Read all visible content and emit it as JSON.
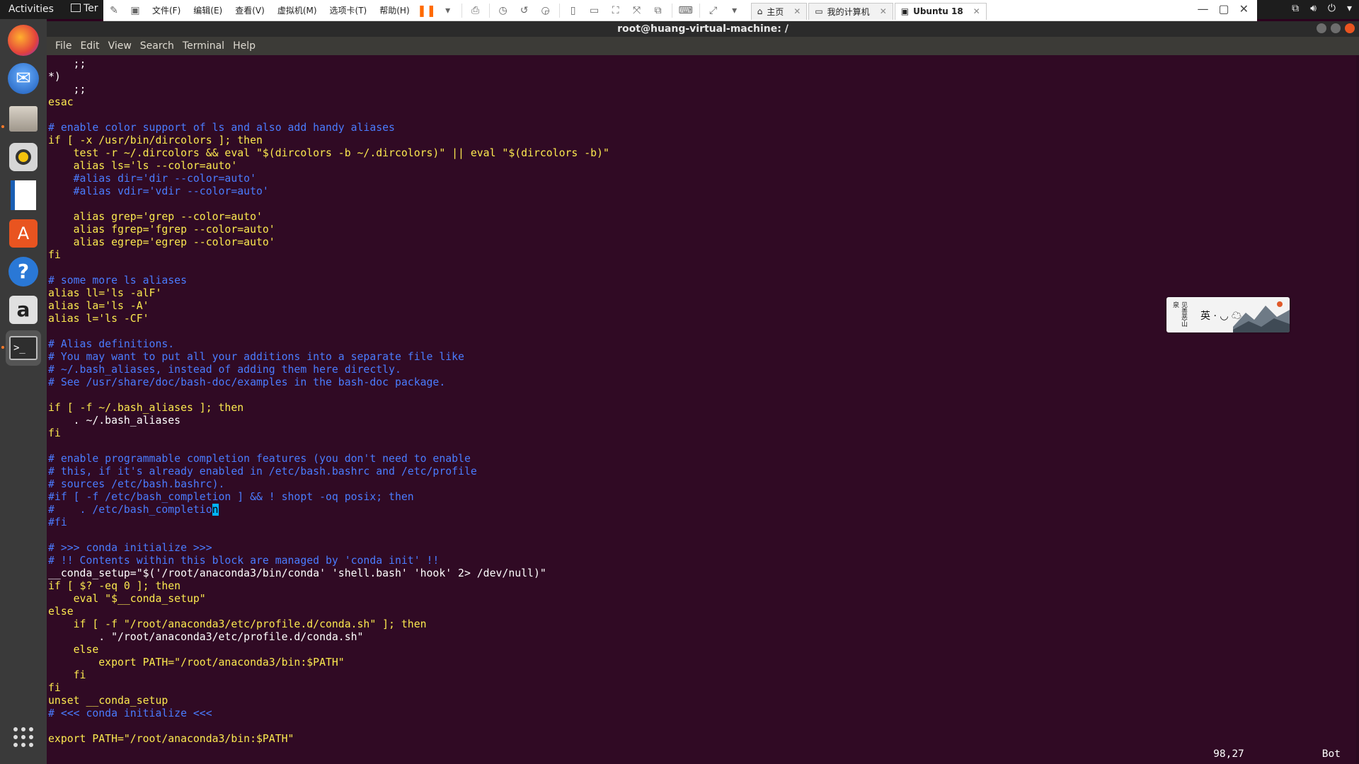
{
  "topbar": {
    "activities": "Activities",
    "app_indicator": "Ter"
  },
  "vmware": {
    "menus": [
      "文件(F)",
      "编辑(E)",
      "查看(V)",
      "虚拟机(M)",
      "选项卡(T)",
      "帮助(H)"
    ],
    "tabs": [
      {
        "label": "主页",
        "active": false
      },
      {
        "label": "我的计算机",
        "active": false
      },
      {
        "label": "Ubuntu 18",
        "active": true
      }
    ]
  },
  "terminal": {
    "title": "root@huang-virtual-machine: /",
    "menu": [
      "File",
      "Edit",
      "View",
      "Search",
      "Terminal",
      "Help"
    ],
    "status_position": "98,27",
    "status_scroll": "Bot"
  },
  "widget": {
    "left_text": "见善恶山泉",
    "mid_text": "英 · ◡ ☁"
  },
  "code_lines": [
    "    ;;",
    "*)",
    "    ;;",
    "esac",
    "",
    "# enable color support of ls and also add handy aliases",
    "if [ -x /usr/bin/dircolors ]; then",
    "    test -r ~/.dircolors && eval \"$(dircolors -b ~/.dircolors)\" || eval \"$(dircolors -b)\"",
    "    alias ls='ls --color=auto'",
    "    #alias dir='dir --color=auto'",
    "    #alias vdir='vdir --color=auto'",
    "",
    "    alias grep='grep --color=auto'",
    "    alias fgrep='fgrep --color=auto'",
    "    alias egrep='egrep --color=auto'",
    "fi",
    "",
    "# some more ls aliases",
    "alias ll='ls -alF'",
    "alias la='ls -A'",
    "alias l='ls -CF'",
    "",
    "# Alias definitions.",
    "# You may want to put all your additions into a separate file like",
    "# ~/.bash_aliases, instead of adding them here directly.",
    "# See /usr/share/doc/bash-doc/examples in the bash-doc package.",
    "",
    "if [ -f ~/.bash_aliases ]; then",
    "    . ~/.bash_aliases",
    "fi",
    "",
    "# enable programmable completion features (you don't need to enable",
    "# this, if it's already enabled in /etc/bash.bashrc and /etc/profile",
    "# sources /etc/bash.bashrc).",
    "#if [ -f /etc/bash_completion ] && ! shopt -oq posix; then",
    "#    . /etc/bash_completion",
    "#fi",
    "",
    "# >>> conda initialize >>>",
    "# !! Contents within this block are managed by 'conda init' !!",
    "__conda_setup=\"$('/root/anaconda3/bin/conda' 'shell.bash' 'hook' 2> /dev/null)\"",
    "if [ $? -eq 0 ]; then",
    "    eval \"$__conda_setup\"",
    "else",
    "    if [ -f \"/root/anaconda3/etc/profile.d/conda.sh\" ]; then",
    "        . \"/root/anaconda3/etc/profile.d/conda.sh\"",
    "    else",
    "        export PATH=\"/root/anaconda3/bin:$PATH\"",
    "    fi",
    "fi",
    "unset __conda_setup",
    "# <<< conda initialize <<<",
    "",
    "export PATH=\"/root/anaconda3/bin:$PATH\""
  ],
  "colors": {
    "terminal_bg": "#300a24",
    "comment": "#4a7cff",
    "keyword": "#fce94f",
    "cursor": "#00b4ff"
  },
  "cursor": {
    "line": 35,
    "col": 26
  }
}
